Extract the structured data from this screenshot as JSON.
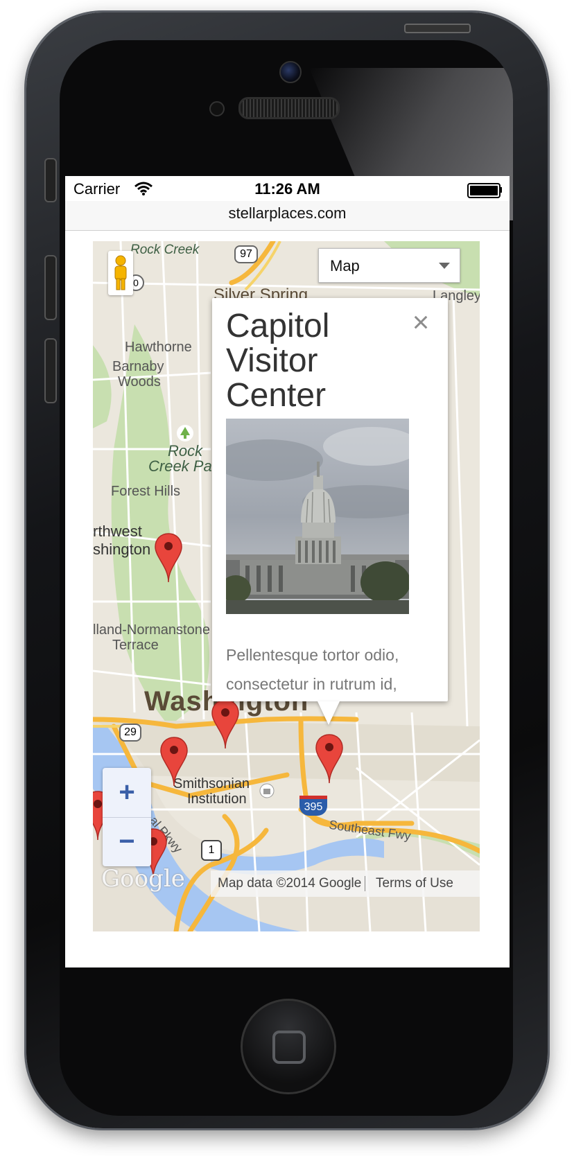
{
  "status_bar": {
    "carrier": "Carrier",
    "time": "11:26 AM"
  },
  "browser": {
    "url": "stellarplaces.com"
  },
  "map": {
    "map_type": {
      "selected": "Map"
    },
    "zoom": {
      "in_label": "+",
      "out_label": "−"
    },
    "labels": {
      "rock_creek": "Rock Creek",
      "silver_spring": "Silver Spring",
      "langley": "Langley",
      "hawthorne": "Hawthorne",
      "barnaby_woods_1": "Barnaby",
      "barnaby_woods_2": "Woods",
      "rock_creek_park_1": "Rock",
      "rock_creek_park_2": "Creek Par",
      "forest_hills": "Forest Hills",
      "northwest_1": "rthwest",
      "northwest_2": "shington",
      "friendship_1": "lland-Normanstone",
      "friendship_2": "Terrace",
      "washington": "Washington",
      "smithsonian_1": "Smithsonian",
      "smithsonian_2": "Institution",
      "southeast_fwy": "Southeast Fwy",
      "parkway": "al Pkwy"
    },
    "shields": {
      "r97": "97",
      "r29": "29",
      "i395": "395",
      "us1": "1",
      "r0": "0"
    },
    "attribution": {
      "data": "Map data ©2014 Google",
      "terms": "Terms of Use",
      "logo": "Google"
    },
    "colors": {
      "pin": "#e8453c",
      "highway": "#f6b73c",
      "water": "#a6c6f2",
      "park": "#c8dfb0"
    }
  },
  "info_window": {
    "title": "Capitol Visitor Center",
    "close": "×",
    "text": "Pellentesque tortor odio, consectetur in rutrum id,"
  }
}
